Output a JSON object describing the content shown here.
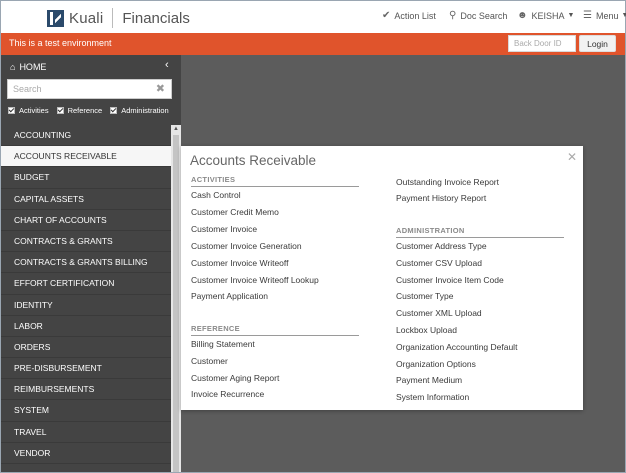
{
  "header": {
    "brand": "Kuali",
    "product": "Financials",
    "action_list": "Action List",
    "doc_search": "Doc Search",
    "user": "KEISHA",
    "menu": "Menu"
  },
  "env_bar": {
    "message": "This is a test environment",
    "backdoor_placeholder": "Back Door ID",
    "login_label": "Login"
  },
  "sidebar": {
    "home_label": "HOME",
    "search_placeholder": "Search",
    "filters": [
      "Activities",
      "Reference",
      "Administration"
    ],
    "items": [
      "ACCOUNTING",
      "ACCOUNTS RECEIVABLE",
      "BUDGET",
      "CAPITAL ASSETS",
      "CHART OF ACCOUNTS",
      "CONTRACTS & GRANTS",
      "CONTRACTS & GRANTS BILLING",
      "EFFORT CERTIFICATION",
      "IDENTITY",
      "LABOR",
      "ORDERS",
      "PRE-DISBURSEMENT",
      "REIMBURSEMENTS",
      "SYSTEM",
      "TRAVEL",
      "VENDOR"
    ],
    "active_index": 1
  },
  "modal": {
    "title": "Accounts Receivable",
    "activities_heading": "ACTIVITIES",
    "activities": [
      "Cash Control",
      "Customer Credit Memo",
      "Customer Invoice",
      "Customer Invoice Generation",
      "Customer Invoice Writeoff",
      "Customer Invoice Writeoff Lookup",
      "Payment Application"
    ],
    "activities_continued": [
      "Outstanding Invoice Report",
      "Payment History Report"
    ],
    "reference_heading": "REFERENCE",
    "reference": [
      "Billing Statement",
      "Customer",
      "Customer Aging Report",
      "Invoice Recurrence"
    ],
    "administration_heading": "ADMINISTRATION",
    "administration": [
      "Customer Address Type",
      "Customer CSV Upload",
      "Customer Invoice Item Code",
      "Customer Type",
      "Customer XML Upload",
      "Lockbox Upload",
      "Organization Accounting Default",
      "Organization Options",
      "Payment Medium",
      "System Information"
    ]
  },
  "colors": {
    "accent_bar": "#e0542c",
    "sidebar_bg": "#444444",
    "backdrop": "#5c5c5c"
  }
}
